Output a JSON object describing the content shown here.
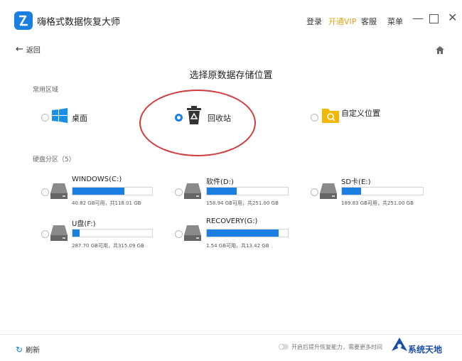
{
  "app": {
    "title": "嗨格式数据恢复大师"
  },
  "titlebar": {
    "login": "登录",
    "vip": "开通VIP",
    "service": "客服",
    "menu": "菜单"
  },
  "nav": {
    "back": "返回"
  },
  "heading": "选择原数据存储位置",
  "common": {
    "label": "常用区域",
    "items": [
      {
        "label": "桌面",
        "selected": false,
        "icon": "windows-desktop-icon"
      },
      {
        "label": "回收站",
        "selected": true,
        "icon": "recycle-bin-icon"
      },
      {
        "label": "自定义位置",
        "selected": false,
        "icon": "folder-search-icon"
      }
    ]
  },
  "disks": {
    "label": "硬盘分区（5）",
    "items": [
      {
        "name": "WINDOWS(C:)",
        "capacity": "40.82 GB可用，共118.01 GB",
        "used_fraction": 0.65
      },
      {
        "name": "软件(D:)",
        "capacity": "158.94 GB可用，共251.00 GB",
        "used_fraction": 0.37
      },
      {
        "name": "SD卡(E:)",
        "capacity": "189.83 GB可用，共251.00 GB",
        "used_fraction": 0.24
      },
      {
        "name": "U盘(F:)",
        "capacity": "287.70 GB可用，共315.09 GB",
        "used_fraction": 0.09
      },
      {
        "name": "RECOVERY(G:)",
        "capacity": "1.54 GB可用，共13.42 GB",
        "used_fraction": 0.89
      }
    ]
  },
  "footer": {
    "refresh": "刷新",
    "toggle_text": "开启后提升恢复能力，需要更多时间"
  },
  "watermark": "系统天地",
  "colors": {
    "accent": "#1a7fe0",
    "vip": "#e3a51a",
    "highlight_circle": "#d23b3b"
  }
}
